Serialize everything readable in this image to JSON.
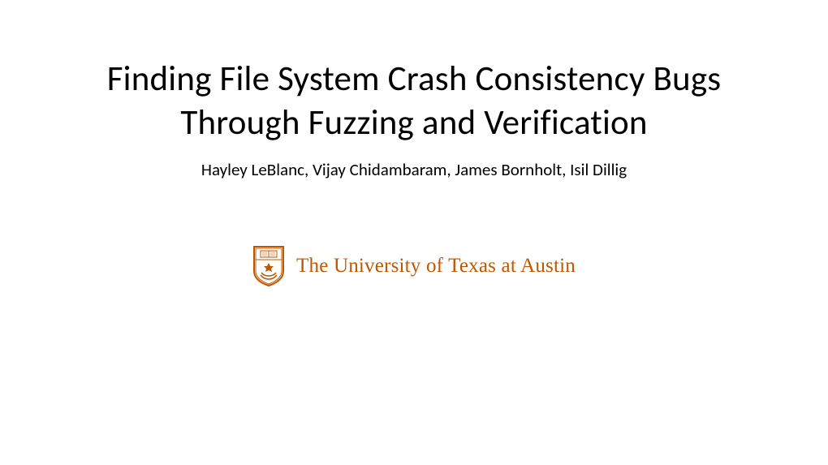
{
  "title": "Finding File System Crash Consistency Bugs Through Fuzzing and Verification",
  "authors": "Hayley LeBlanc, Vijay Chidambaram, James Bornholt, Isil Dillig",
  "university": {
    "name": "The University of Texas at Austin",
    "color": "#bf5700"
  }
}
